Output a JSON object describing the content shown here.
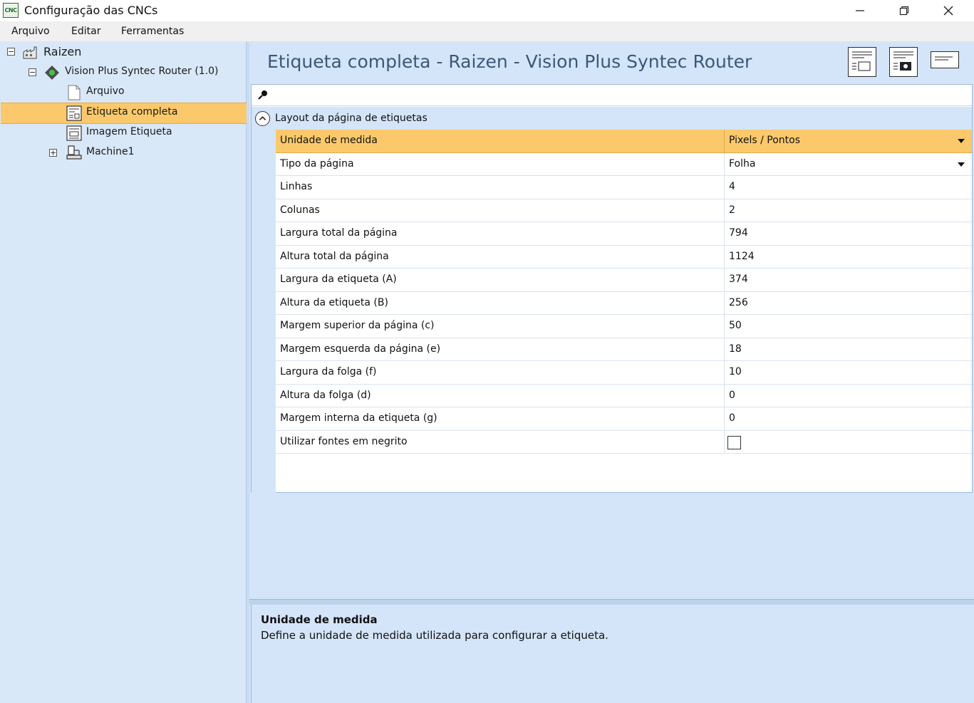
{
  "window": {
    "icon_text": "CNC",
    "title": "Configuração das CNCs",
    "controls": [
      "minimize",
      "maximize",
      "close"
    ]
  },
  "menu": {
    "items": [
      "Arquivo",
      "Editar",
      "Ferramentas"
    ]
  },
  "tree": {
    "items": [
      {
        "label": "Raizen",
        "icon": "factory-icon",
        "expander": "⊟"
      },
      {
        "label": "Vision Plus Syntec Router (1.0)",
        "icon": "cnc-machine-icon",
        "expander": "⊟"
      },
      {
        "label": "Arquivo",
        "icon": "file-icon"
      },
      {
        "label": "Etiqueta completa",
        "icon": "label-sheet-icon",
        "selected": true
      },
      {
        "label": "Imagem Etiqueta",
        "icon": "label-image-icon"
      },
      {
        "label": "Machine1",
        "icon": "machine-icon",
        "expander": "⊞"
      }
    ]
  },
  "main": {
    "title": "Etiqueta completa - Raizen - Vision Plus Syntec Router",
    "toolbar": [
      "label-layout-icon",
      "label-photo-icon",
      "label-text-icon"
    ],
    "category": "Layout da página de etiquetas",
    "properties": [
      {
        "name": "Unidade de medida",
        "value": "Pixels / Pontos",
        "dropdown": true,
        "selected": true
      },
      {
        "name": "Tipo da página",
        "value": "Folha",
        "dropdown": true
      },
      {
        "name": "Linhas",
        "value": "4"
      },
      {
        "name": "Colunas",
        "value": "2"
      },
      {
        "name": "Largura total da página",
        "value": "794"
      },
      {
        "name": "Altura total da página",
        "value": "1124"
      },
      {
        "name": "Largura da etiqueta (A)",
        "value": "374"
      },
      {
        "name": "Altura da etiqueta (B)",
        "value": "256"
      },
      {
        "name": "Margem superior da página (c)",
        "value": "50"
      },
      {
        "name": "Margem esquerda da página (e)",
        "value": "18"
      },
      {
        "name": "Largura da folga (f)",
        "value": "10"
      },
      {
        "name": "Altura da folga (d)",
        "value": "0"
      },
      {
        "name": "Margem interna da etiqueta (g)",
        "value": "0"
      },
      {
        "name": "Utilizar fontes em negrito",
        "checkbox": true,
        "checked": false
      }
    ],
    "description": {
      "title": "Unidade de medida",
      "text": "Define a unidade de medida utilizada para configurar a etiqueta."
    }
  }
}
